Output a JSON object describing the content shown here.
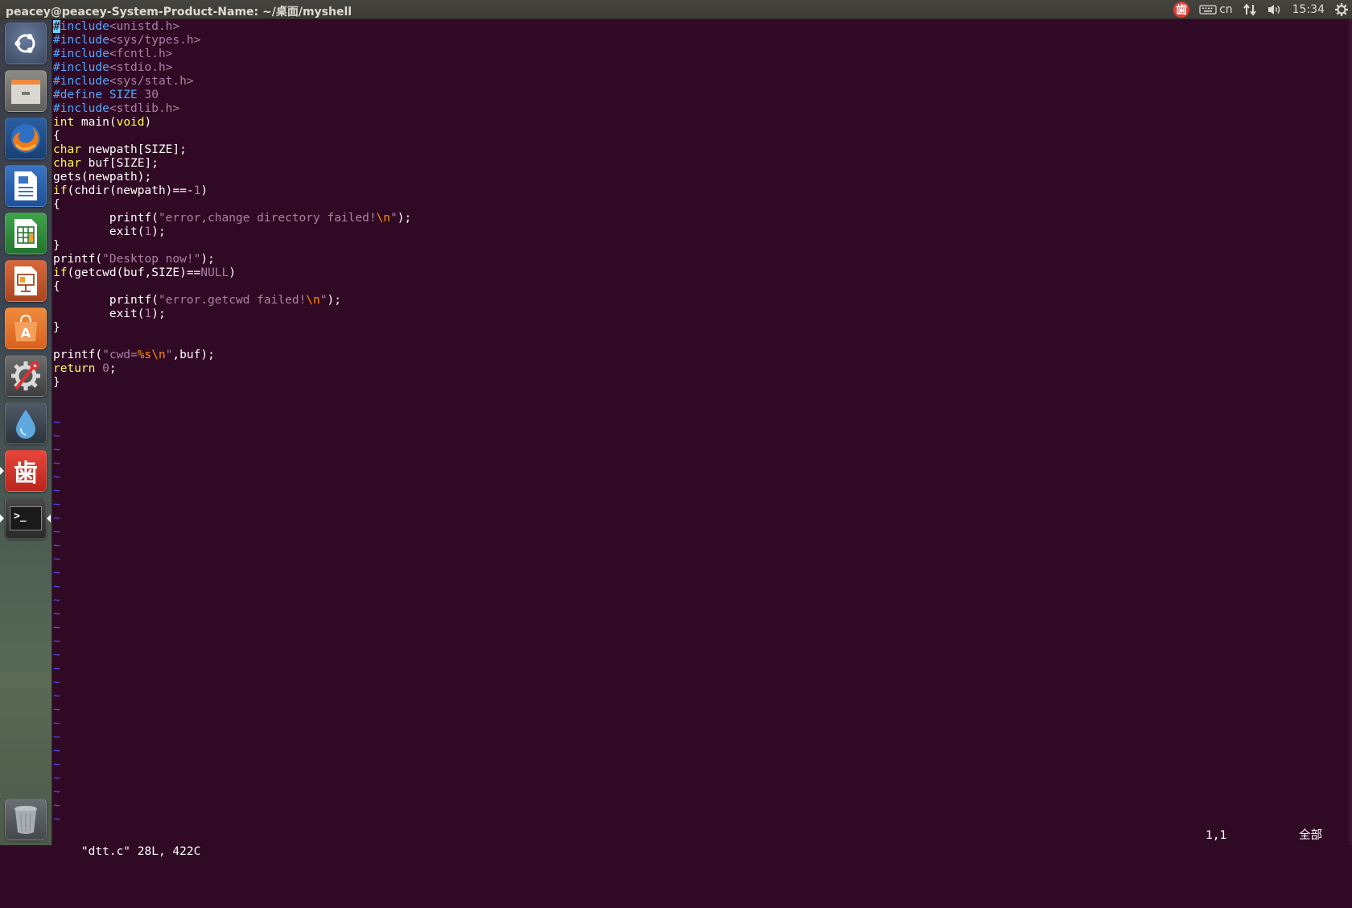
{
  "window": {
    "title": "peacey@peacey-System-Product-Name: ~/桌面/myshell"
  },
  "panel": {
    "netease_label": "歯",
    "keyboard_label": "cn",
    "clock": "15:34",
    "icons": [
      "netease-music-icon",
      "keyboard-icon",
      "network-icon",
      "volume-icon",
      "power-gear-icon"
    ]
  },
  "launcher": {
    "items": [
      {
        "name": "dash-icon"
      },
      {
        "name": "files-icon"
      },
      {
        "name": "firefox-icon"
      },
      {
        "name": "writer-icon"
      },
      {
        "name": "calc-icon"
      },
      {
        "name": "impress-icon"
      },
      {
        "name": "software-center-icon"
      },
      {
        "name": "system-settings-icon"
      },
      {
        "name": "drop-app-icon"
      },
      {
        "name": "netease-music-icon"
      },
      {
        "name": "terminal-icon"
      },
      {
        "name": "trash-icon"
      }
    ],
    "terminal_glyph": ">_",
    "netease_glyph": "歯",
    "software_glyph": "A"
  },
  "editor": {
    "lines": [
      [
        {
          "t": "#",
          "c": "cursor"
        },
        {
          "t": "include",
          "c": "pp"
        },
        {
          "t": "<unistd.h>",
          "c": "st"
        }
      ],
      [
        {
          "t": "#include",
          "c": "pp"
        },
        {
          "t": "<sys/types.h>",
          "c": "st"
        }
      ],
      [
        {
          "t": "#include",
          "c": "pp"
        },
        {
          "t": "<fcntl.h>",
          "c": "st"
        }
      ],
      [
        {
          "t": "#include",
          "c": "pp"
        },
        {
          "t": "<stdio.h>",
          "c": "st"
        }
      ],
      [
        {
          "t": "#include",
          "c": "pp"
        },
        {
          "t": "<sys/stat.h>",
          "c": "st"
        }
      ],
      [
        {
          "t": "#define",
          "c": "pp"
        },
        {
          "t": " "
        },
        {
          "t": "SIZE",
          "c": "pp"
        },
        {
          "t": " "
        },
        {
          "t": "30",
          "c": "nm"
        }
      ],
      [
        {
          "t": "#include",
          "c": "pp"
        },
        {
          "t": "<stdlib.h>",
          "c": "st"
        }
      ],
      [
        {
          "t": "int",
          "c": "kw"
        },
        {
          "t": " main("
        },
        {
          "t": "void",
          "c": "kw"
        },
        {
          "t": ")"
        }
      ],
      [
        {
          "t": "{"
        }
      ],
      [
        {
          "t": "char",
          "c": "kw"
        },
        {
          "t": " newpath[SIZE];"
        }
      ],
      [
        {
          "t": "char",
          "c": "kw"
        },
        {
          "t": " buf[SIZE];"
        }
      ],
      [
        {
          "t": "gets(newpath);"
        }
      ],
      [
        {
          "t": "if",
          "c": "kw"
        },
        {
          "t": "(chdir(newpath)==-"
        },
        {
          "t": "1",
          "c": "nm"
        },
        {
          "t": ")"
        }
      ],
      [
        {
          "t": "{"
        }
      ],
      [
        {
          "t": "        printf("
        },
        {
          "t": "\"error,change directory failed!",
          "c": "st"
        },
        {
          "t": "\\n",
          "c": "sc"
        },
        {
          "t": "\"",
          "c": "st"
        },
        {
          "t": ");"
        }
      ],
      [
        {
          "t": "        exit("
        },
        {
          "t": "1",
          "c": "nm"
        },
        {
          "t": ");"
        }
      ],
      [
        {
          "t": "}"
        }
      ],
      [
        {
          "t": "printf("
        },
        {
          "t": "\"Desktop now!\"",
          "c": "st"
        },
        {
          "t": ");"
        }
      ],
      [
        {
          "t": "if",
          "c": "kw"
        },
        {
          "t": "(getcwd(buf,SIZE)=="
        },
        {
          "t": "NULL",
          "c": "nm"
        },
        {
          "t": ")"
        }
      ],
      [
        {
          "t": "{"
        }
      ],
      [
        {
          "t": "        printf("
        },
        {
          "t": "\"error.getcwd failed!",
          "c": "st"
        },
        {
          "t": "\\n",
          "c": "sc"
        },
        {
          "t": "\"",
          "c": "st"
        },
        {
          "t": ");"
        }
      ],
      [
        {
          "t": "        exit("
        },
        {
          "t": "1",
          "c": "nm"
        },
        {
          "t": ");"
        }
      ],
      [
        {
          "t": "}"
        }
      ],
      [
        {
          "t": ""
        }
      ],
      [
        {
          "t": "printf("
        },
        {
          "t": "\"cwd=",
          "c": "st"
        },
        {
          "t": "%s\\n",
          "c": "sc"
        },
        {
          "t": "\"",
          "c": "st"
        },
        {
          "t": ",buf);"
        }
      ],
      [
        {
          "t": "return",
          "c": "kw"
        },
        {
          "t": " "
        },
        {
          "t": "0",
          "c": "nm"
        },
        {
          "t": ";"
        }
      ],
      [
        {
          "t": "}"
        }
      ]
    ],
    "tilde_char": "~",
    "tilde_count": 30,
    "status": {
      "file_info": "\"dtt.c\" 28L, 422C",
      "position": "1,1",
      "percent": "全部"
    }
  }
}
